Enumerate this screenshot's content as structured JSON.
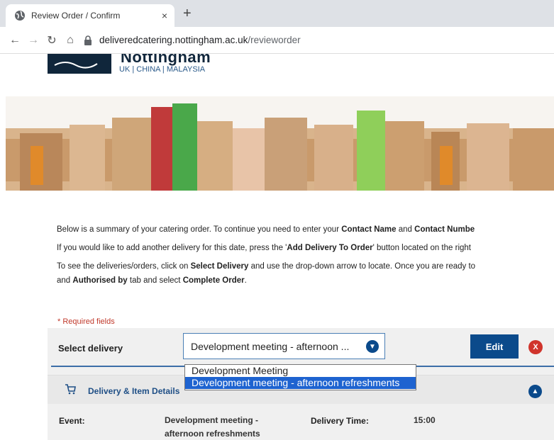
{
  "browser": {
    "tab_title": "Review Order / Confirm",
    "close_glyph": "×",
    "new_tab_glyph": "+",
    "url_host": "deliveredcatering.nottingham.ac.uk",
    "url_path": "/revieworder"
  },
  "header": {
    "logo_name": "Nottingham",
    "logo_sub": "UK | CHINA | MALAYSIA"
  },
  "intro": {
    "p1_a": "Below is a summary of your catering order.  To continue you need to enter your ",
    "p1_b": "Contact Name",
    "p1_c": " and ",
    "p1_d": "Contact Numbe",
    "p2_a": "If you would like to add another delivery for this date, press the '",
    "p2_b": "Add Delivery To Order",
    "p2_c": "' button located on the right",
    "p3_a": "To see the deliveries/orders, click on ",
    "p3_b": "Select Delivery",
    "p3_c": " and use the drop-down arrow to locate.  Once you are ready to",
    "p4_a": "and ",
    "p4_b": "Authorised by",
    "p4_c": " tab and select ",
    "p4_d": "Complete Order",
    "p4_e": "."
  },
  "form": {
    "required_note": "* Required fields",
    "select_label": "Select delivery",
    "select_value": "Development meeting - afternoon ...",
    "edit_label": "Edit",
    "remove_glyph": "X",
    "options": [
      "Development Meeting",
      "Development meeting - afternoon refreshments"
    ]
  },
  "section": {
    "title": "Delivery & Item Details",
    "event_label": "Event:",
    "event_value_1": "Development meeting -",
    "event_value_2": "afternoon refreshments",
    "time_label": "Delivery Time:",
    "time_value": "15:00"
  },
  "colors": {
    "brand_navy": "#10263b",
    "button_blue": "#0b4a8b",
    "danger_red": "#d0342c",
    "highlight": "#1e63d0"
  }
}
